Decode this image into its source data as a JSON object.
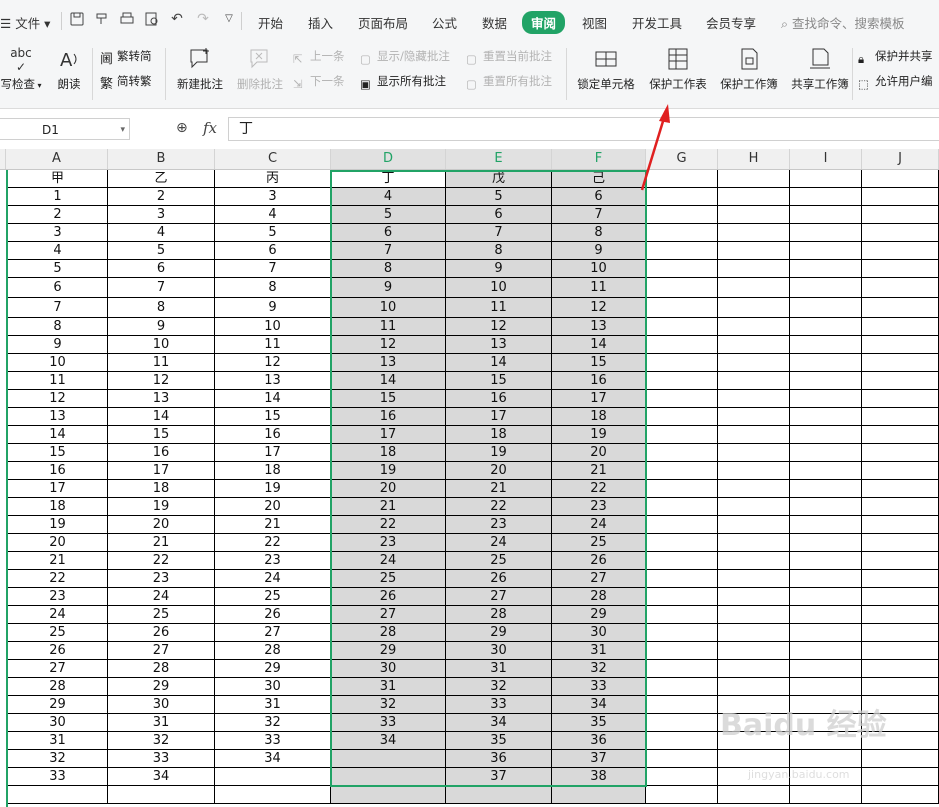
{
  "menu": {
    "file_label": "文件",
    "tabs": [
      "开始",
      "插入",
      "页面布局",
      "公式",
      "数据",
      "审阅",
      "视图",
      "开发工具",
      "会员专享"
    ],
    "active_tab": "审阅",
    "search_placeholder": "查找命令、搜索模板"
  },
  "ribbon": {
    "spell_check": "写检查",
    "spell_check_icon_text": "abc",
    "read_aloud": "朗读",
    "to_traditional": "繁转简",
    "to_simplified": "简转繁",
    "new_comment": "新建批注",
    "delete_comment": "删除批注",
    "prev_comment": "上一条",
    "next_comment": "下一条",
    "show_hide_comment": "显示/隐藏批注",
    "show_all_comments": "显示所有批注",
    "reset_current_comment": "重置当前批注",
    "reset_all_comments": "重置所有批注",
    "lock_cell": "锁定单元格",
    "protect_sheet": "保护工作表",
    "protect_workbook": "保护工作簿",
    "share_workbook": "共享工作簿",
    "protect_and_share": "保护并共享",
    "allow_users_edit": "允许用户编"
  },
  "formula_bar": {
    "name_box": "D1",
    "fx_label": "fx",
    "formula_value": "丁"
  },
  "columns": [
    "A",
    "B",
    "C",
    "D",
    "E",
    "F",
    "G",
    "H",
    "I",
    "J"
  ],
  "selected_columns": [
    "D",
    "E",
    "F"
  ],
  "rows": [
    [
      "甲",
      "乙",
      "丙",
      "丁",
      "戊",
      "己"
    ],
    [
      "1",
      "2",
      "3",
      "4",
      "5",
      "6"
    ],
    [
      "2",
      "3",
      "4",
      "5",
      "6",
      "7"
    ],
    [
      "3",
      "4",
      "5",
      "6",
      "7",
      "8"
    ],
    [
      "4",
      "5",
      "6",
      "7",
      "8",
      "9"
    ],
    [
      "5",
      "6",
      "7",
      "8",
      "9",
      "10"
    ],
    [
      "6",
      "7",
      "8",
      "9",
      "10",
      "11"
    ],
    [
      "7",
      "8",
      "9",
      "10",
      "11",
      "12"
    ],
    [
      "8",
      "9",
      "10",
      "11",
      "12",
      "13"
    ],
    [
      "9",
      "10",
      "11",
      "12",
      "13",
      "14"
    ],
    [
      "10",
      "11",
      "12",
      "13",
      "14",
      "15"
    ],
    [
      "11",
      "12",
      "13",
      "14",
      "15",
      "16"
    ],
    [
      "12",
      "13",
      "14",
      "15",
      "16",
      "17"
    ],
    [
      "13",
      "14",
      "15",
      "16",
      "17",
      "18"
    ],
    [
      "14",
      "15",
      "16",
      "17",
      "18",
      "19"
    ],
    [
      "15",
      "16",
      "17",
      "18",
      "19",
      "20"
    ],
    [
      "16",
      "17",
      "18",
      "19",
      "20",
      "21"
    ],
    [
      "17",
      "18",
      "19",
      "20",
      "21",
      "22"
    ],
    [
      "18",
      "19",
      "20",
      "21",
      "22",
      "23"
    ],
    [
      "19",
      "20",
      "21",
      "22",
      "23",
      "24"
    ],
    [
      "20",
      "21",
      "22",
      "23",
      "24",
      "25"
    ],
    [
      "21",
      "22",
      "23",
      "24",
      "25",
      "26"
    ],
    [
      "22",
      "23",
      "24",
      "25",
      "26",
      "27"
    ],
    [
      "23",
      "24",
      "25",
      "26",
      "27",
      "28"
    ],
    [
      "24",
      "25",
      "26",
      "27",
      "28",
      "29"
    ],
    [
      "25",
      "26",
      "27",
      "28",
      "29",
      "30"
    ],
    [
      "26",
      "27",
      "28",
      "29",
      "30",
      "31"
    ],
    [
      "27",
      "28",
      "29",
      "30",
      "31",
      "32"
    ],
    [
      "28",
      "29",
      "30",
      "31",
      "32",
      "33"
    ],
    [
      "29",
      "30",
      "31",
      "32",
      "33",
      "34"
    ],
    [
      "30",
      "31",
      "32",
      "33",
      "34",
      "35"
    ],
    [
      "31",
      "32",
      "33",
      "34",
      "35",
      "36"
    ],
    [
      "32",
      "33",
      "34",
      "",
      "36",
      "37"
    ],
    [
      "33",
      "34",
      "",
      "",
      "37",
      "38"
    ],
    [
      "",
      "",
      "",
      "",
      "",
      ""
    ]
  ],
  "watermark": {
    "brand": "Baidu 经验",
    "url": "jingyan.baidu.com"
  },
  "colors": {
    "accent": "#21a366",
    "selection_fill": "#d9d9d9",
    "annotation_arrow": "#e02020"
  }
}
